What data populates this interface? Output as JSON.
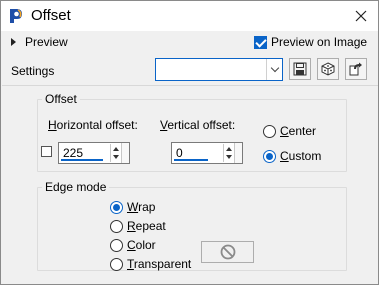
{
  "window": {
    "title": "Offset"
  },
  "preview": {
    "label": "Preview",
    "preview_on_image_label": "Preview on Image",
    "preview_on_image_checked": true
  },
  "settings": {
    "label": "Settings",
    "value": ""
  },
  "offset": {
    "legend": "Offset",
    "horizontal_label_prefix": "H",
    "horizontal_label_rest": "orizontal offset:",
    "horizontal_value": "225",
    "vertical_label_prefix": "V",
    "vertical_label_rest": "ertical offset:",
    "vertical_value": "0",
    "mode_options": [
      {
        "prefix": "C",
        "rest": "enter",
        "selected": false
      },
      {
        "prefix": "C",
        "rest": "ustom",
        "selected": true
      }
    ]
  },
  "edge_mode": {
    "legend": "Edge mode",
    "options": [
      {
        "prefix": "W",
        "rest": "rap",
        "selected": true
      },
      {
        "prefix": "R",
        "rest": "epeat",
        "selected": false
      },
      {
        "prefix": "C",
        "rest": "olor",
        "selected": false
      },
      {
        "prefix": "T",
        "rest": "ransparent",
        "selected": false
      }
    ]
  },
  "icons": {
    "app": "app-logo-icon",
    "close": "close-icon",
    "save": "save-icon",
    "random": "dice-icon",
    "reset": "reset-icon",
    "disabled": "disabled-circle-icon"
  },
  "colors": {
    "accent": "#0a64c8",
    "background": "#f0f0f0"
  }
}
